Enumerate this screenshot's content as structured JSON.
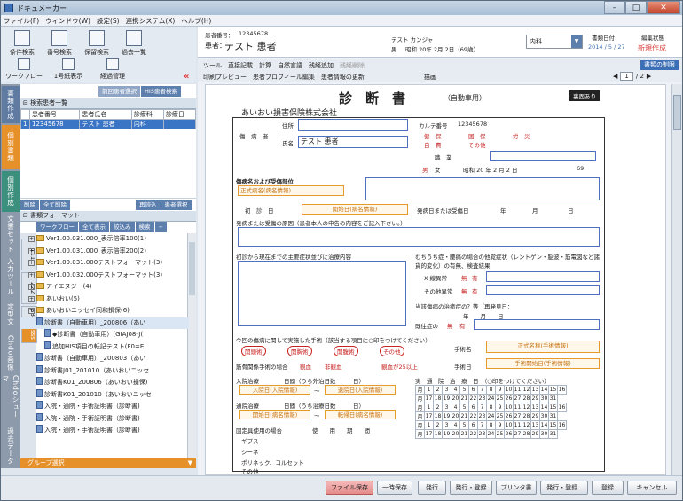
{
  "window": {
    "title": "ドキュメーカー",
    "min": "–",
    "max": "□",
    "close": "✕"
  },
  "menu": [
    "ファイル(F)",
    "ウィンドウ(W)",
    "設定(S)",
    "連携システム(X)",
    "ヘルプ(H)"
  ],
  "toolbar": [
    {
      "label": "条件検索",
      "icon": "search-icon"
    },
    {
      "label": "番号検索",
      "icon": "number-search-icon"
    },
    {
      "label": "保留検索",
      "icon": "hold-search-icon"
    },
    {
      "label": "過去一覧",
      "icon": "history-icon"
    },
    {
      "label": "ワークフロー",
      "icon": "workflow-icon"
    },
    {
      "label": "1号紙表示",
      "icon": "sheet-icon"
    },
    {
      "label": "経過管理",
      "icon": "progress-icon"
    }
  ],
  "left_tabs": [
    "書類作成",
    "個別書類",
    "個別作成",
    "文書セット",
    "入力ツール",
    "定型文",
    "Chdo画像",
    "Chdoシューマ",
    "過去データ"
  ],
  "patient_tabs": [
    "前回患者選択",
    "HIS患者検索"
  ],
  "patient_list": {
    "title": "検索患者一覧",
    "headers": [
      "",
      "患者番号",
      "患者氏名",
      "診療科",
      "診療日"
    ],
    "rows": [
      [
        "1",
        "12345678",
        "テスト 患者",
        "内科",
        ""
      ]
    ]
  },
  "patient_buttons": [
    "削除",
    "全て削除",
    "再読込",
    "患者選択"
  ],
  "format": {
    "title": "書類フォーマット",
    "tabs": [
      "ワークフロー",
      "全て表示",
      "絞込み",
      "検索",
      "−"
    ],
    "side": [
      "111",
      "222",
      "333",
      "sss"
    ],
    "tree": [
      {
        "t": "Ver1.00.031.000_表示倍率100(1)",
        "k": "fold",
        "l": 1
      },
      {
        "t": "Ver1.00.031.000_表示倍率200(2)",
        "k": "fold",
        "l": 1
      },
      {
        "t": "Ver1.00.031.000テストフォーマット(3)",
        "k": "fold",
        "l": 1
      },
      {
        "t": "Ver1.00.032.000テストフォーマット(3)",
        "k": "fold",
        "l": 1
      },
      {
        "t": "アイエヌジー(4)",
        "k": "fold",
        "l": 1
      },
      {
        "t": "あいおい(5)",
        "k": "fold",
        "l": 1
      },
      {
        "t": "あいおいニッセイ同和損保(6)",
        "k": "fold",
        "l": 1
      },
      {
        "t": "診断書（自動車用）_200806（あい",
        "k": "doc",
        "l": 2
      },
      {
        "t": "◆診断書（自動車用）[GIAJ08-J(",
        "k": "doc",
        "l": 3
      },
      {
        "t": "追加HIS項目の転記テスト(F0=E",
        "k": "doc",
        "l": 3
      },
      {
        "t": "診断書（自動車用）_200803（あい",
        "k": "doc",
        "l": 2
      },
      {
        "t": "診断書J01_201010（あいおいニッセ",
        "k": "doc",
        "l": 2
      },
      {
        "t": "診断書K01_200806（あいおい損保)",
        "k": "doc",
        "l": 2
      },
      {
        "t": "診断書K01_201010（あいおいニッセ",
        "k": "doc",
        "l": 2
      },
      {
        "t": "入院・通院・手術証明書（診断書)",
        "k": "doc",
        "l": 2
      },
      {
        "t": "入院・通院・手術証明書（診断書)",
        "k": "doc",
        "l": 2
      },
      {
        "t": "入院・通院・手術証明書（診断書)",
        "k": "doc",
        "l": 2
      }
    ],
    "group": "グループ選択"
  },
  "header": {
    "patient_no_label": "患者番号：",
    "patient_no": "12345678",
    "patient_label": "患者：",
    "patient_name": "テスト 患者",
    "kana": "テスト カンジャ",
    "sex": "男",
    "dob": "昭和 20年 2月 2日（69歳）",
    "dept": "内科",
    "date_label": "書類日付",
    "date": "2014 / 5 / 27",
    "status_label": "編集状態",
    "status": "新規作成"
  },
  "tools": {
    "row1": [
      "ツール",
      "直接記載",
      "計算",
      "自然言語",
      "残経追加",
      "残経削除"
    ],
    "row2": [
      "印刷プレビュー",
      "患者プロフィール編集",
      "患者情報の更新"
    ],
    "draw": "描画",
    "limit": "書類の制限",
    "page": "1",
    "pages": "/ 2",
    "zoom": "100%"
  },
  "form": {
    "title": "診　断　書",
    "sub": "（自動車用）",
    "back": "裏面あり",
    "company": "あいおい損害保険株式会社",
    "chart_label": "カルテ番号",
    "chart_no": "12345678",
    "injured": "傷　病　者",
    "addr_label": "住所",
    "name_label": "氏名",
    "name": "テスト 患者",
    "occupation": "職　業",
    "birth": "昭和 20 年 2 月 2 日",
    "age": "69",
    "sex_options": [
      "男",
      "女"
    ],
    "insured": [
      "健　保",
      "国　保",
      "労　災",
      "自　費",
      "その他"
    ],
    "disease": "傷病名および受傷部位",
    "disease_ph": "正式病名(病名情報)",
    "first_exam": "初　診　日",
    "start_date": "開始日(病名情報)",
    "onset": "発病日または受傷日",
    "onset_ymd": [
      "年",
      "月",
      "日"
    ],
    "cause": "発病または受傷の原因（患者本人の申告の内容をご記入下さい。）",
    "course": "初診から現在までの主要症状並びに治療内容",
    "exam": "むちうち症・腰痛の場合の他覚症状（レントゲン・脳波・筋電図など諸貨的変化）の有無、検査結果",
    "xray": "X 線異常",
    "other": "その他異常",
    "yn": [
      "無",
      "有"
    ],
    "current": "当該傷病の治癒症の？等（再発見日：",
    "year_month": "年　　月　　日",
    "ex": "既往症の",
    "ex_yn": [
      "無",
      "有"
    ],
    "surgery": "今回の傷病に関して実施した手術（該当する項目に○印をつけてください）",
    "surg_types": [
      "開頭術",
      "開胸術",
      "開腹術",
      "その他"
    ],
    "surg_name": "手術名",
    "surg_name_ph": "正式名称(手術情報)",
    "surg_date": "手術日",
    "surg_date_ph": "手術開始日(手術情報)",
    "bone": "筋骨関係手術の場合",
    "bone_types": [
      "観血",
      "非観血"
    ],
    "bone_extra": "観血が25以上",
    "bone_extra2": "25以下の場合",
    "admit": "入院治療",
    "admit_days": "日間（うち外泊日数　　　日）",
    "admit_from": "入院日(入院情報)",
    "admit_to": "退院日(入院情報)",
    "arrow": "〜",
    "outpatient": "通院治療",
    "out_days": "日間（うち治療日数　　　日）",
    "out_from": "開始日(病名情報)",
    "out_to": "転帰日(病名情報)",
    "device": "固定具使用の場合",
    "use_period": "使　　用　　期　　間",
    "device_items": [
      "ギプス",
      "シーネ",
      "ポリネック、コルセット",
      "その他"
    ],
    "cal_title": "実　通　院　治　療　日　（○印をつけてください）",
    "cal_days_1": [
      "1",
      "2",
      "3",
      "4",
      "5",
      "6",
      "7",
      "8",
      "9",
      "10",
      "11",
      "12",
      "13",
      "14",
      "15",
      "16"
    ],
    "cal_days_2": [
      "17",
      "18",
      "19",
      "20",
      "21",
      "22",
      "23",
      "24",
      "25",
      "26",
      "27",
      "28",
      "29",
      "30",
      "31"
    ],
    "cal_month": "月"
  },
  "bottom": [
    "ファイル保存",
    "一時保存",
    "発行",
    "発行・登録",
    "プリンタ書",
    "発行・登録..",
    "登録",
    "キャンセル"
  ]
}
